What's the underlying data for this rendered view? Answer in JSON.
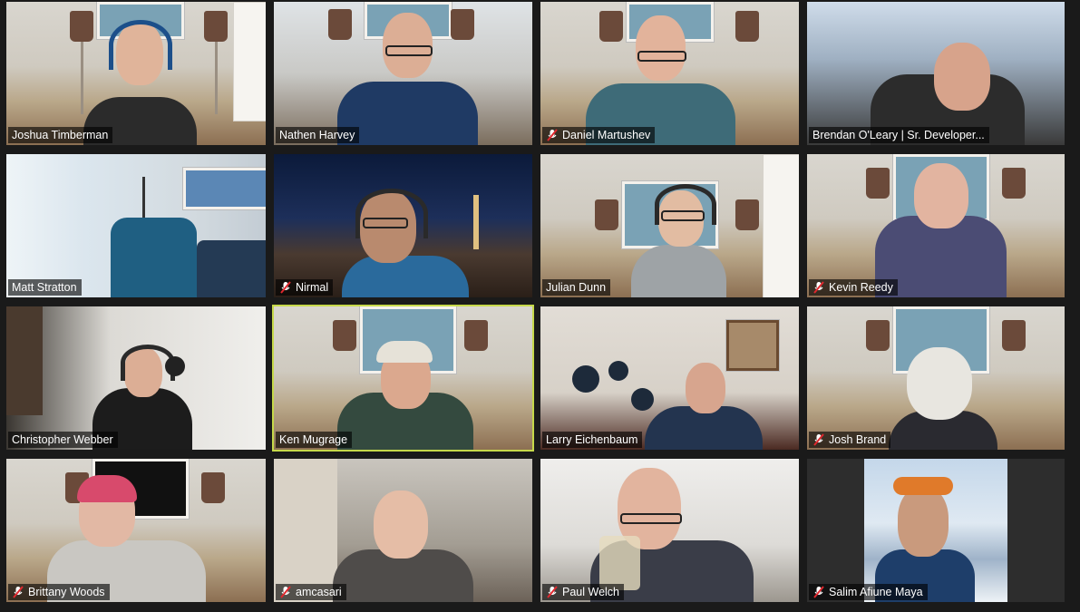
{
  "participants": [
    {
      "name": "Joshua Timberman",
      "muted": false,
      "active": false
    },
    {
      "name": "Nathen Harvey",
      "muted": false,
      "active": false
    },
    {
      "name": "Daniel Martushev",
      "muted": true,
      "active": false
    },
    {
      "name": "Brendan O'Leary | Sr. Developer...",
      "muted": false,
      "active": false
    },
    {
      "name": "Matt Stratton",
      "muted": false,
      "active": false
    },
    {
      "name": "Nirmal",
      "muted": true,
      "active": false
    },
    {
      "name": "Julian Dunn",
      "muted": false,
      "active": false
    },
    {
      "name": "Kevin Reedy",
      "muted": true,
      "active": false
    },
    {
      "name": "Christopher Webber",
      "muted": false,
      "active": false
    },
    {
      "name": "Ken Mugrage",
      "muted": false,
      "active": true
    },
    {
      "name": "Larry Eichenbaum",
      "muted": false,
      "active": false
    },
    {
      "name": "Josh Brand",
      "muted": true,
      "active": false
    },
    {
      "name": "Brittany Woods",
      "muted": true,
      "active": false
    },
    {
      "name": "amcasari",
      "muted": true,
      "active": false
    },
    {
      "name": "Paul Welch",
      "muted": true,
      "active": false
    },
    {
      "name": "Salim Afiune Maya",
      "muted": true,
      "active": false
    }
  ],
  "colors": {
    "active_speaker_border": "#c6d94a",
    "mute_icon": "#e0282e",
    "background": "#1a1a1a"
  },
  "icons": {
    "muted": "microphone-muted-icon"
  }
}
